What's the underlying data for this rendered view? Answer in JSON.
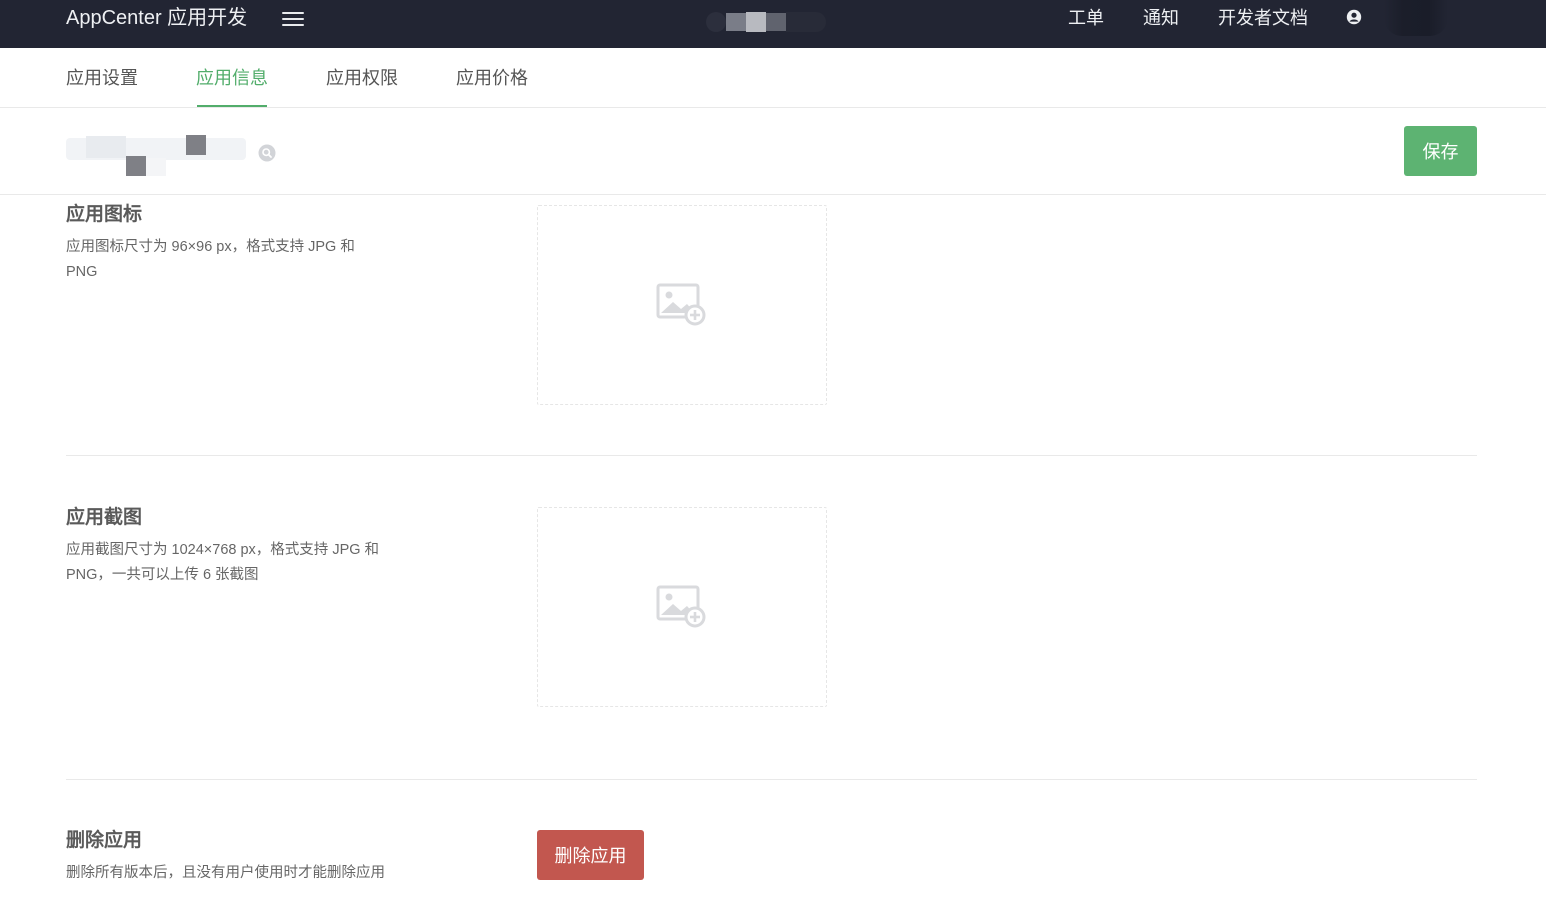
{
  "header": {
    "brand": "AppCenter 应用开发",
    "nav": [
      "工单",
      "通知",
      "开发者文档"
    ],
    "menu_icon": "hamburger-menu-icon",
    "user_icon": "user-icon"
  },
  "tabs": [
    {
      "label": "应用设置",
      "active": false
    },
    {
      "label": "应用信息",
      "active": true
    },
    {
      "label": "应用权限",
      "active": false
    },
    {
      "label": "应用价格",
      "active": false
    }
  ],
  "toolbar": {
    "save_label": "保存"
  },
  "sections": {
    "icon": {
      "title": "应用图标",
      "desc": "应用图标尺寸为 96×96 px，格式支持 JPG 和 PNG"
    },
    "screenshot": {
      "title": "应用截图",
      "desc": "应用截图尺寸为 1024×768 px，格式支持 JPG 和 PNG，一共可以上传 6 张截图"
    },
    "delete": {
      "title": "删除应用",
      "desc": "删除所有版本后，且没有用户使用时才能删除应用",
      "button_label": "删除应用"
    }
  },
  "colors": {
    "topbar_bg": "#222533",
    "accent_green": "#52ad6b",
    "save_button": "#5db372",
    "danger": "#c2574f"
  }
}
